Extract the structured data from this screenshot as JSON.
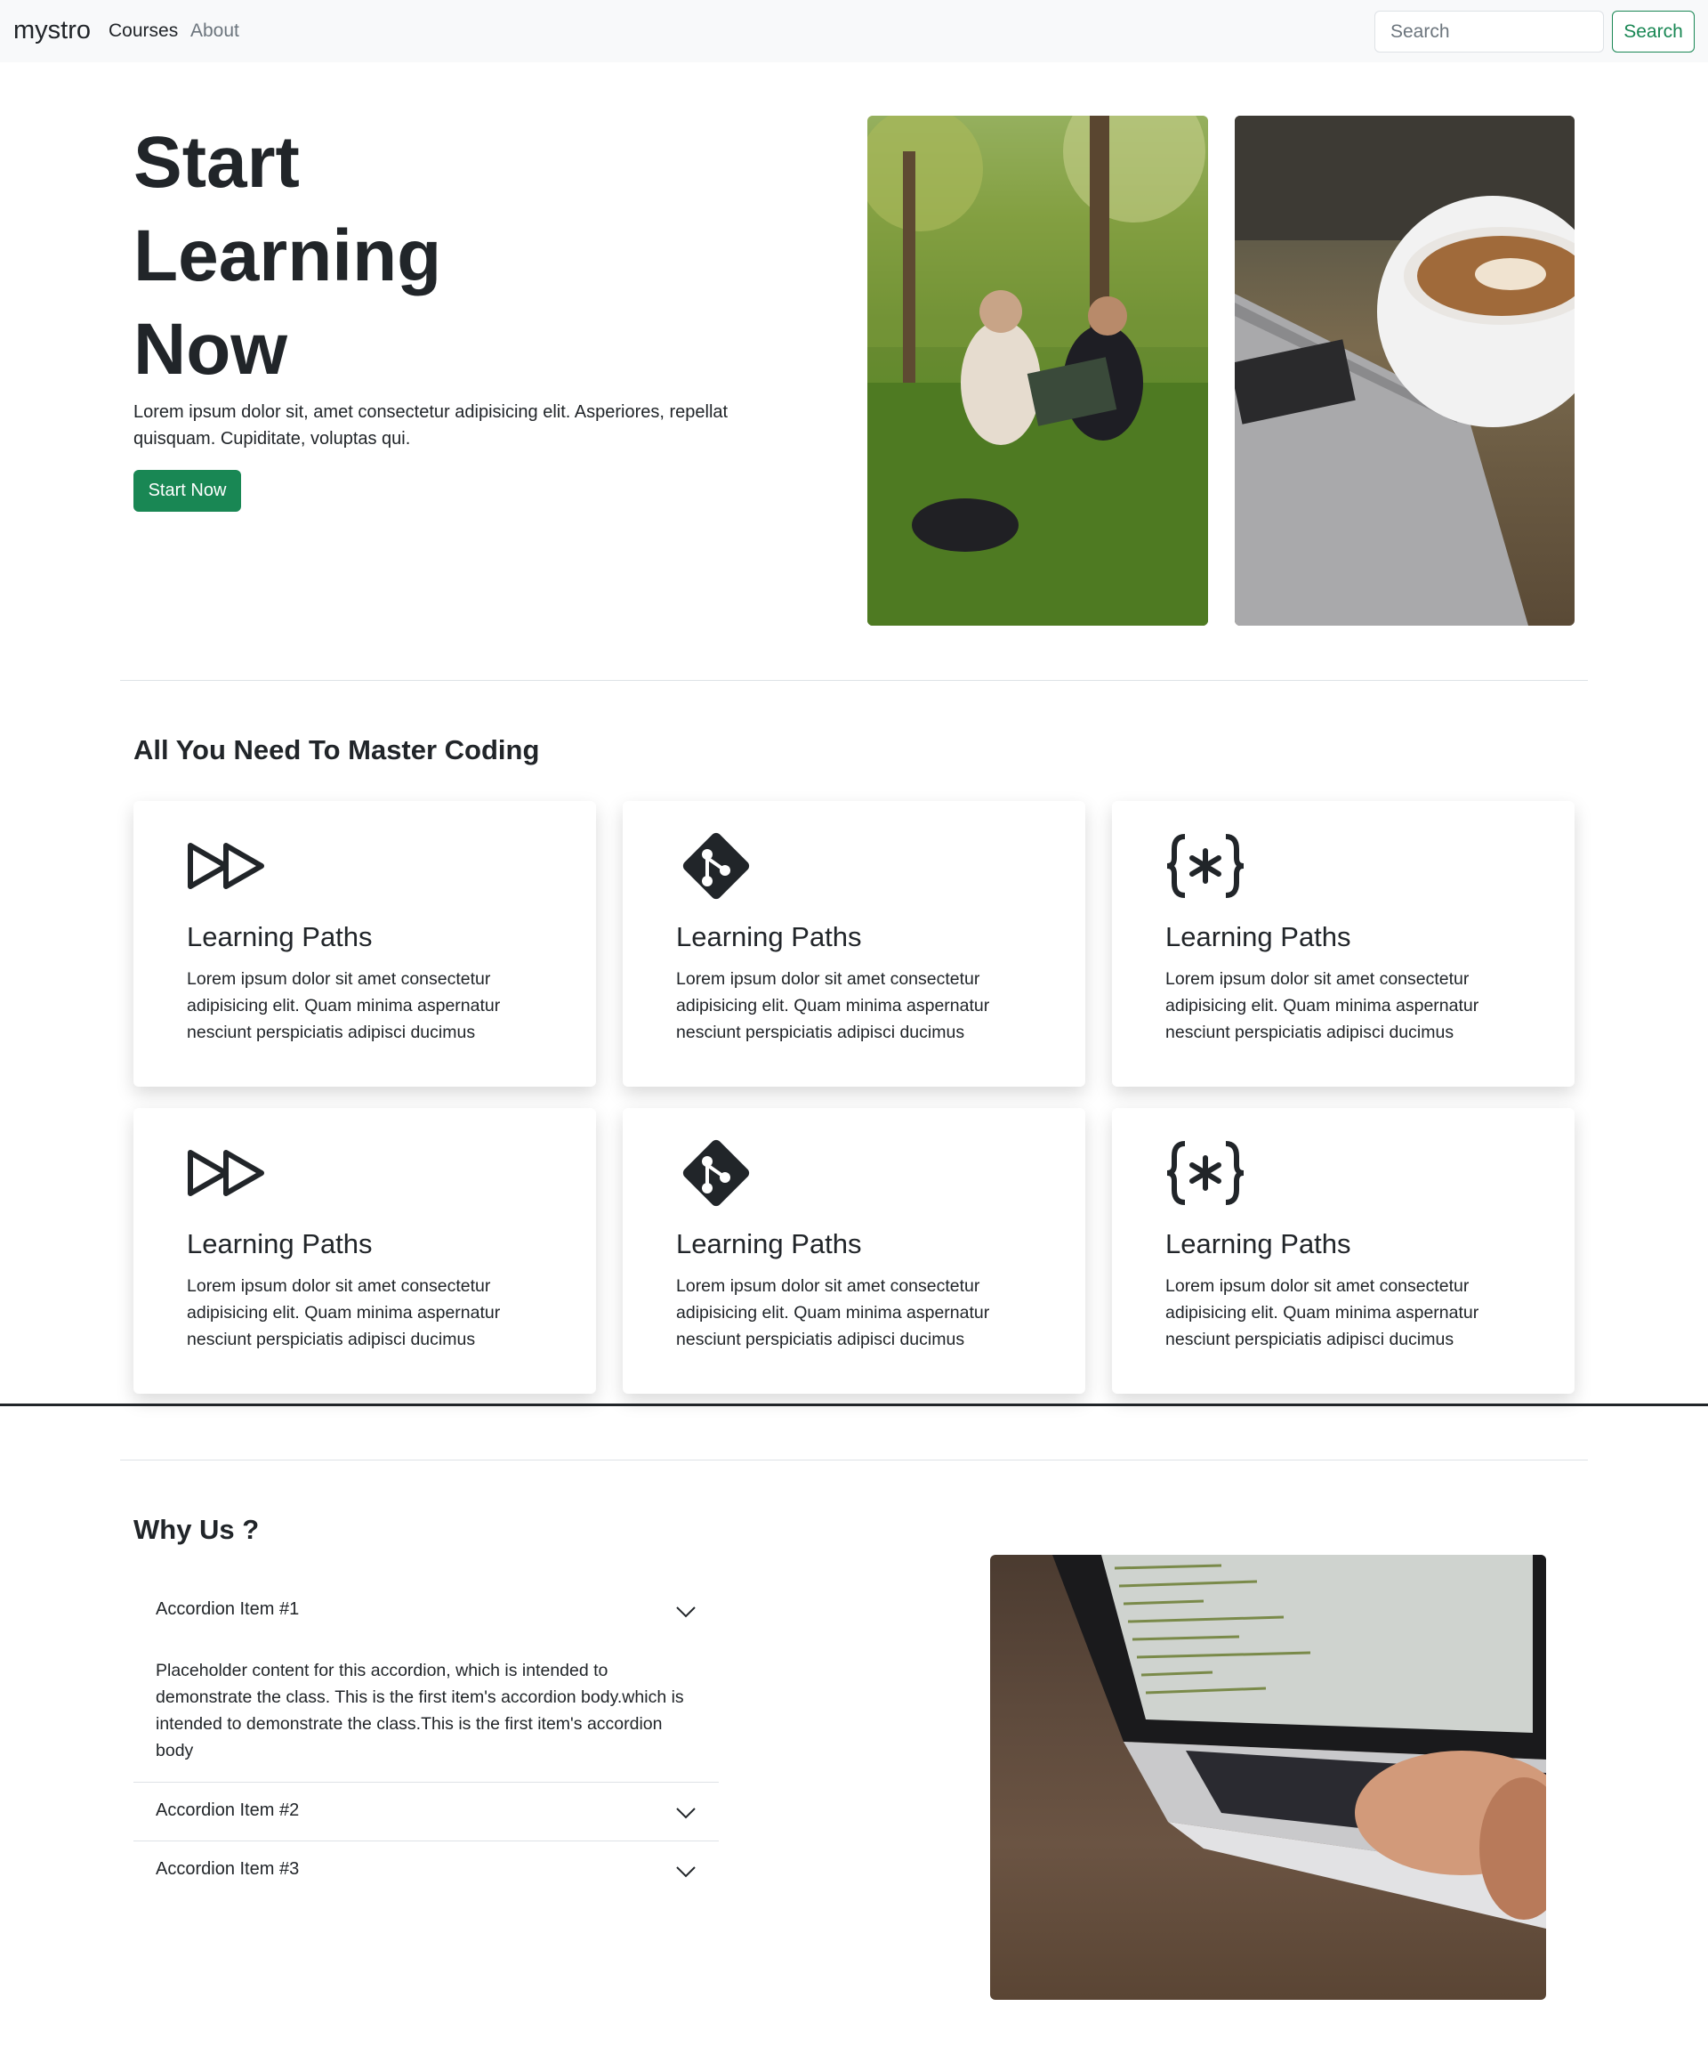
{
  "navbar": {
    "brand": "mystro",
    "links": [
      "Courses",
      "About"
    ],
    "search_placeholder": "Search",
    "search_button": "Search"
  },
  "hero": {
    "title_lines": [
      "Start",
      "Learning",
      "Now"
    ],
    "text": "Lorem ipsum dolor sit, amet consectetur adipisicing elit. Asperiores, repellat quisquam. Cupiditate, voluptas qui.",
    "button": "Start Now"
  },
  "features": {
    "title": "All You Need To Master Coding",
    "cards": [
      {
        "icon": "fast-forward-icon",
        "title": "Learning Paths",
        "text": "Lorem ipsum dolor sit amet consectetur adipisicing elit. Quam minima aspernatur nesciunt perspiciatis adipisci ducimus"
      },
      {
        "icon": "git-icon",
        "title": "Learning Paths",
        "text": "Lorem ipsum dolor sit amet consectetur adipisicing elit. Quam minima aspernatur nesciunt perspiciatis adipisci ducimus"
      },
      {
        "icon": "code-braces-asterisk-icon",
        "title": "Learning Paths",
        "text": "Lorem ipsum dolor sit amet consectetur adipisicing elit. Quam minima aspernatur nesciunt perspiciatis adipisci ducimus"
      },
      {
        "icon": "fast-forward-icon",
        "title": "Learning Paths",
        "text": "Lorem ipsum dolor sit amet consectetur adipisicing elit. Quam minima aspernatur nesciunt perspiciatis adipisci ducimus"
      },
      {
        "icon": "git-icon",
        "title": "Learning Paths",
        "text": "Lorem ipsum dolor sit amet consectetur adipisicing elit. Quam minima aspernatur nesciunt perspiciatis adipisci ducimus"
      },
      {
        "icon": "code-braces-asterisk-icon",
        "title": "Learning Paths",
        "text": "Lorem ipsum dolor sit amet consectetur adipisicing elit. Quam minima aspernatur nesciunt perspiciatis adipisci ducimus"
      }
    ]
  },
  "why": {
    "title": "Why Us ?",
    "accordion": [
      {
        "label": "Accordion Item #1",
        "body": "Placeholder content for this accordion, which is intended to demonstrate the class. This is the first item's accordion body.which is intended to demonstrate the class.This is the first item's accordion body",
        "expanded": true
      },
      {
        "label": "Accordion Item #2",
        "body": "",
        "expanded": false
      },
      {
        "label": "Accordion Item #3",
        "body": "",
        "expanded": false
      }
    ]
  },
  "colors": {
    "primary_green": "#198754",
    "text_dark": "#212529",
    "muted": "#6c757d",
    "navbar_bg": "#f8f9fa"
  }
}
